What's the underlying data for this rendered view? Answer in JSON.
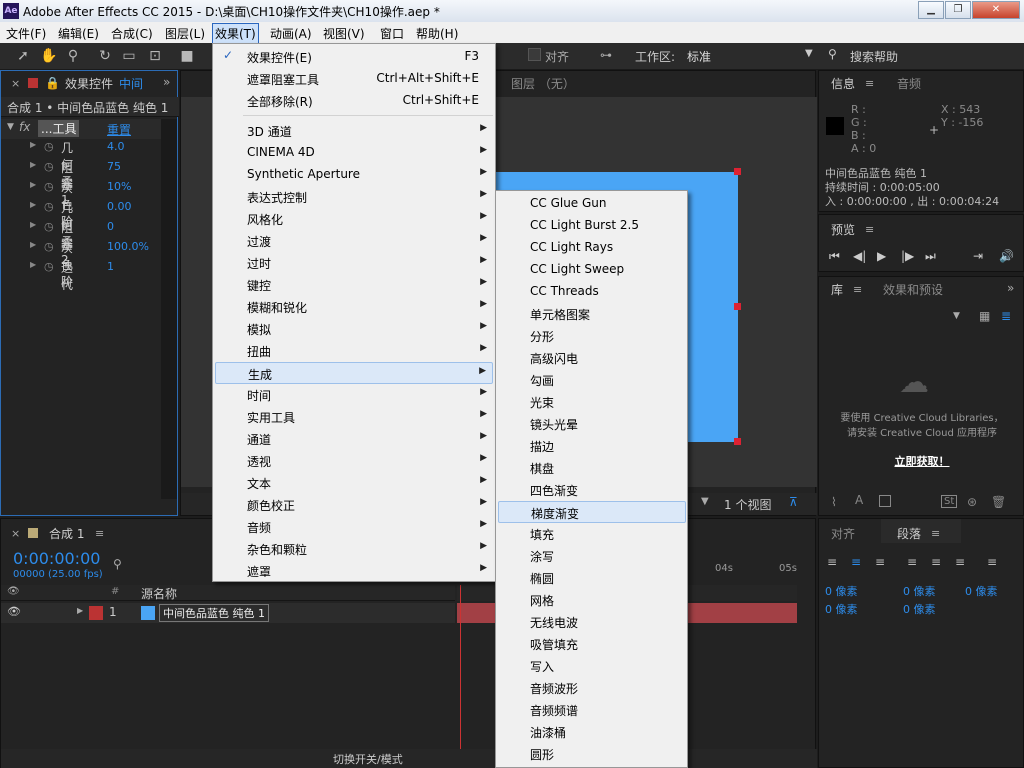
{
  "window": {
    "title": "Adobe After Effects CC 2015 - D:\\桌面\\CH10操作文件夹\\CH10操作.aep *",
    "logo": "Ae"
  },
  "menubar": [
    "文件(F)",
    "编辑(E)",
    "合成(C)",
    "图层(L)",
    "效果(T)",
    "动画(A)",
    "视图(V)",
    "窗口",
    "帮助(H)"
  ],
  "toolbar": {
    "align_label": "对齐",
    "workspace_label": "工作区:",
    "workspace_value": "标准",
    "search_placeholder": "搜索帮助"
  },
  "effect_controls": {
    "tab": "效果控件",
    "tab_extra": "中间",
    "layer_label": "合成 1 • 中间色品蓝色 纯色 1",
    "effect_name": "...工具",
    "reset": "重置",
    "params": [
      {
        "name": "几何柔",
        "value": "4.0"
      },
      {
        "name": "阻塞 1",
        "value": "75"
      },
      {
        "name": "灰色阶",
        "value": "10%"
      },
      {
        "name": "几何柔",
        "value": "0.00"
      },
      {
        "name": "阻塞 2",
        "value": "0"
      },
      {
        "name": "灰色阶",
        "value": "100.0%"
      },
      {
        "name": "迭代",
        "value": "1"
      }
    ]
  },
  "composition": {
    "layer_tab": "图层 （无）",
    "color": "#4aa5f5",
    "views": "1 个视图"
  },
  "effects_menu": {
    "items": [
      {
        "label": "效果控件(E)",
        "shortcut": "F3",
        "checked": true
      },
      {
        "label": "遮罩阻塞工具",
        "shortcut": "Ctrl+Alt+Shift+E"
      },
      {
        "label": "全部移除(R)",
        "shortcut": "Ctrl+Shift+E"
      },
      {
        "label": "3D 通道",
        "sub": true
      },
      {
        "label": "CINEMA 4D",
        "sub": true
      },
      {
        "label": "Synthetic Aperture",
        "sub": true
      },
      {
        "label": "表达式控制",
        "sub": true
      },
      {
        "label": "风格化",
        "sub": true
      },
      {
        "label": "过渡",
        "sub": true
      },
      {
        "label": "过时",
        "sub": true
      },
      {
        "label": "键控",
        "sub": true
      },
      {
        "label": "模糊和锐化",
        "sub": true
      },
      {
        "label": "模拟",
        "sub": true
      },
      {
        "label": "扭曲",
        "sub": true
      },
      {
        "label": "生成",
        "sub": true,
        "hl": true
      },
      {
        "label": "时间",
        "sub": true
      },
      {
        "label": "实用工具",
        "sub": true
      },
      {
        "label": "通道",
        "sub": true
      },
      {
        "label": "透视",
        "sub": true
      },
      {
        "label": "文本",
        "sub": true
      },
      {
        "label": "颜色校正",
        "sub": true
      },
      {
        "label": "音频",
        "sub": true
      },
      {
        "label": "杂色和颗粒",
        "sub": true
      },
      {
        "label": "遮罩",
        "sub": true
      }
    ]
  },
  "generate_submenu": {
    "items": [
      "CC Glue Gun",
      "CC Light Burst 2.5",
      "CC Light Rays",
      "CC Light Sweep",
      "CC Threads",
      "单元格图案",
      "分形",
      "高级闪电",
      "勾画",
      "光束",
      "镜头光晕",
      "描边",
      "棋盘",
      "四色渐变",
      "梯度渐变",
      "填充",
      "涂写",
      "椭圆",
      "网格",
      "无线电波",
      "吸管填充",
      "写入",
      "音频波形",
      "音频频谱",
      "油漆桶",
      "圆形"
    ],
    "highlighted": "梯度渐变"
  },
  "info_panel": {
    "tab_info": "信息",
    "tab_audio": "音频",
    "r": "R :",
    "g": "G :",
    "b": "B :",
    "a": "A : 0",
    "x": "X : 543",
    "y": "Y : -156",
    "layer": "中间色品蓝色 纯色 1",
    "duration": "持续时间 : 0:00:05:00",
    "inout": "入 : 0:00:00:00 , 出 : 0:00:04:24"
  },
  "preview_panel": {
    "tab": "预览"
  },
  "library_panel": {
    "tab": "库",
    "tab2": "效果和预设",
    "msg1": "要使用 Creative Cloud Libraries，",
    "msg2": "请安装 Creative Cloud 应用程序",
    "link": "立即获取！"
  },
  "paragraph_panel": {
    "tab_align": "对齐",
    "tab_para": "段落",
    "fields": [
      "0 像素",
      "0 像素",
      "0 像素",
      "0 像素",
      "0 像素"
    ]
  },
  "timeline": {
    "tab": "合成 1",
    "time": "0:00:00:00",
    "fps": "00000 (25.00 fps)",
    "col_source": "源名称",
    "layer_num": "1",
    "layer_name": "中间色品蓝色 纯色 1",
    "ruler": [
      "04s",
      "05s"
    ],
    "switch_mode": "切换开关/模式"
  }
}
